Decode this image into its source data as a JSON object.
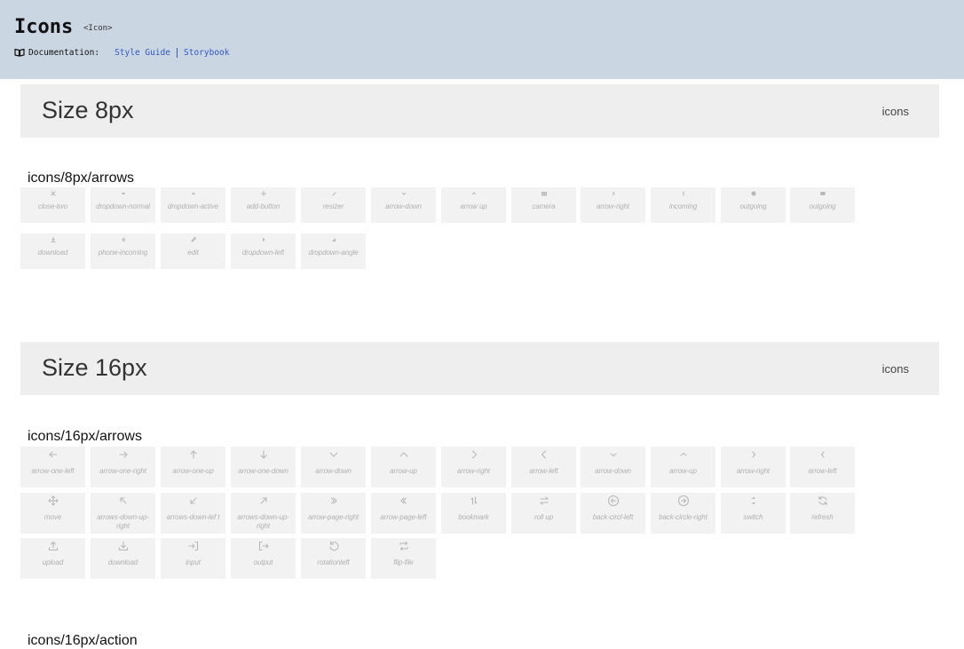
{
  "header": {
    "title": "Icons",
    "tag": "<Icon>",
    "doc_label": "Documentation:",
    "links": [
      "Style Guide",
      "Storybook"
    ]
  },
  "sections": [
    {
      "title": "Size 8px",
      "tag": "icons"
    },
    {
      "title": "Size 16px",
      "tag": "icons"
    }
  ],
  "groups": {
    "g8_arrows": {
      "title": "icons/8px/arrows",
      "items": [
        "close-two",
        "dropdown-normal",
        "dropdown-active",
        "add-button",
        "resizer",
        "arrow-down",
        "arrow up",
        "camera",
        "arrow-right",
        "incoming",
        "outgoing",
        "outgoing",
        "download",
        "phone-incoming",
        "edit",
        "dropdown-left",
        "dropdown-angle"
      ]
    },
    "g16_arrows": {
      "title": "icons/16px/arrows",
      "items": [
        "arrow-one-left",
        "arrow-one-right",
        "arrow-one-up",
        "arrow-one-down",
        "arrow-down",
        "arrow-up",
        "arrow-right",
        "arrow-left",
        "arrow-down",
        "arrow-up",
        "arrow-right",
        "arrow-left",
        "move",
        "arrows-down-up-right",
        "arrows-down-lef t",
        "arrows-down-up-right",
        "arrow-page-right",
        "arrow-page-left",
        "bookmark",
        "roll up",
        "back-circl-left",
        "back-circle-right",
        "switch",
        "refresh",
        "upload",
        "download",
        "input",
        "output",
        "rotationleft",
        "flip-file"
      ]
    },
    "g16_action": {
      "title": "icons/16px/action"
    }
  }
}
